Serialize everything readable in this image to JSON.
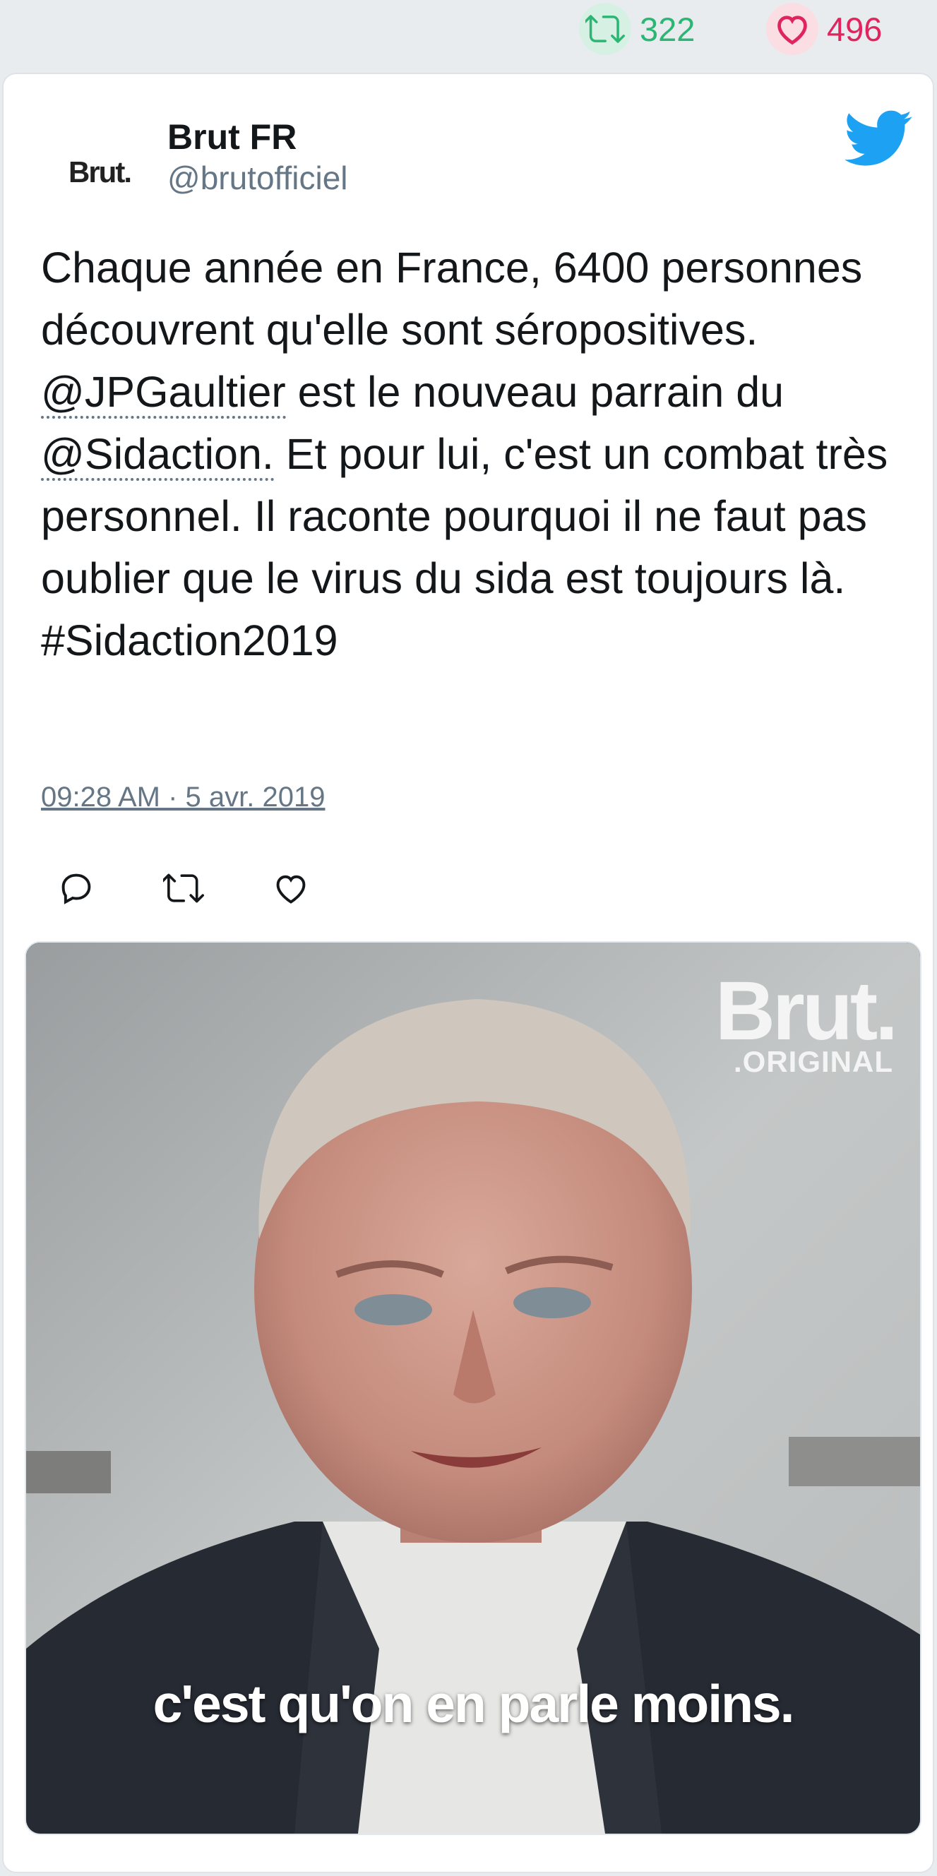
{
  "stats": {
    "retweets": "322",
    "likes": "496"
  },
  "tweet": {
    "avatar_text": "Brut.",
    "name": "Brut FR",
    "handle": "@brutofficiel",
    "text_1": "Chaque année en France, 6400 personnes découvrent qu'elle sont séropositives. ",
    "mention_1": "@JPGaultier",
    "text_2": " est le nouveau parrain du ",
    "mention_2": "@Sidaction.",
    "text_3": " Et pour lui, c'est un combat très personnel. Il raconte pourquoi il ne faut pas oublier que le virus du sida est toujours là. #Sidaction2019",
    "timestamp": "09:28 AM · 5 avr. 2019"
  },
  "media": {
    "watermark_brand": "Brut.",
    "watermark_sub": ".ORIGINAL",
    "subtitle": "c'est qu'on en parle moins."
  },
  "colors": {
    "retweet": "#2bb673",
    "like": "#e0245e",
    "twitter_blue": "#1da1f2",
    "secondary_text": "#657786"
  },
  "icons": [
    "retweet-icon",
    "heart-icon",
    "twitter-bird-icon",
    "reply-icon"
  ]
}
